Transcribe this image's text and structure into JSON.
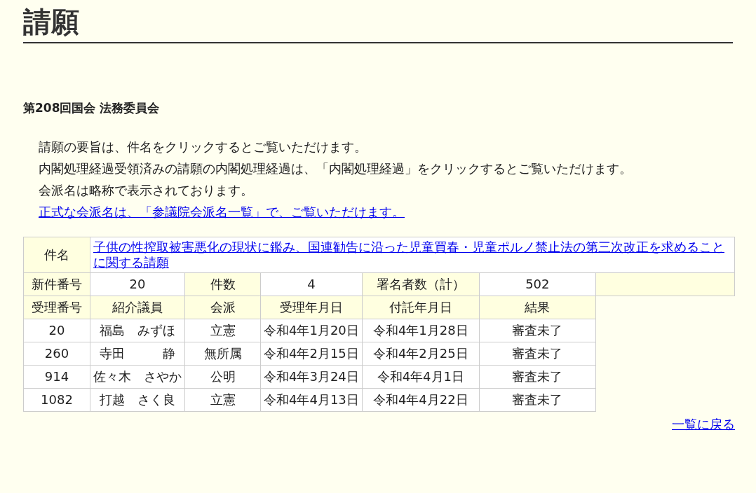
{
  "page_title": "請願",
  "heading": "第208回国会 法務委員会",
  "notes": [
    "請願の要旨は、件名をクリックするとご覧いただけます。",
    "内閣処理経過受領済みの請願の内閣処理経過は、「内閣処理経過」をクリックするとご覧いただけます。",
    "会派名は略称で表示されております。"
  ],
  "notes_link": "正式な会派名は、「参議院会派名一覧」で、ご覧いただけます。",
  "table": {
    "subject_label": "件名",
    "subject_link": "子供の性搾取被害悪化の現状に鑑み、国連勧告に沿った児童買春・児童ポルノ禁止法の第三次改正を求めることに関する請願",
    "summary": [
      {
        "label": "新件番号",
        "value": "20"
      },
      {
        "label": "件数",
        "value": "4"
      },
      {
        "label": "署名者数（計）",
        "value": "502"
      }
    ],
    "columns": [
      "受理番号",
      "紹介議員",
      "会派",
      "受理年月日",
      "付託年月日",
      "結果"
    ],
    "rows": [
      [
        "20",
        "福島　みずほ",
        "立憲",
        "令和4年1月20日",
        "令和4年1月28日",
        "審査未了"
      ],
      [
        "260",
        "寺田　　　静",
        "無所属",
        "令和4年2月15日",
        "令和4年2月25日",
        "審査未了"
      ],
      [
        "914",
        "佐々木　さやか",
        "公明",
        "令和4年3月24日",
        "令和4年4月1日",
        "審査未了"
      ],
      [
        "1082",
        "打越　さく良",
        "立憲",
        "令和4年4月13日",
        "令和4年4月22日",
        "審査未了"
      ]
    ]
  },
  "back_link": "一覧に戻る"
}
